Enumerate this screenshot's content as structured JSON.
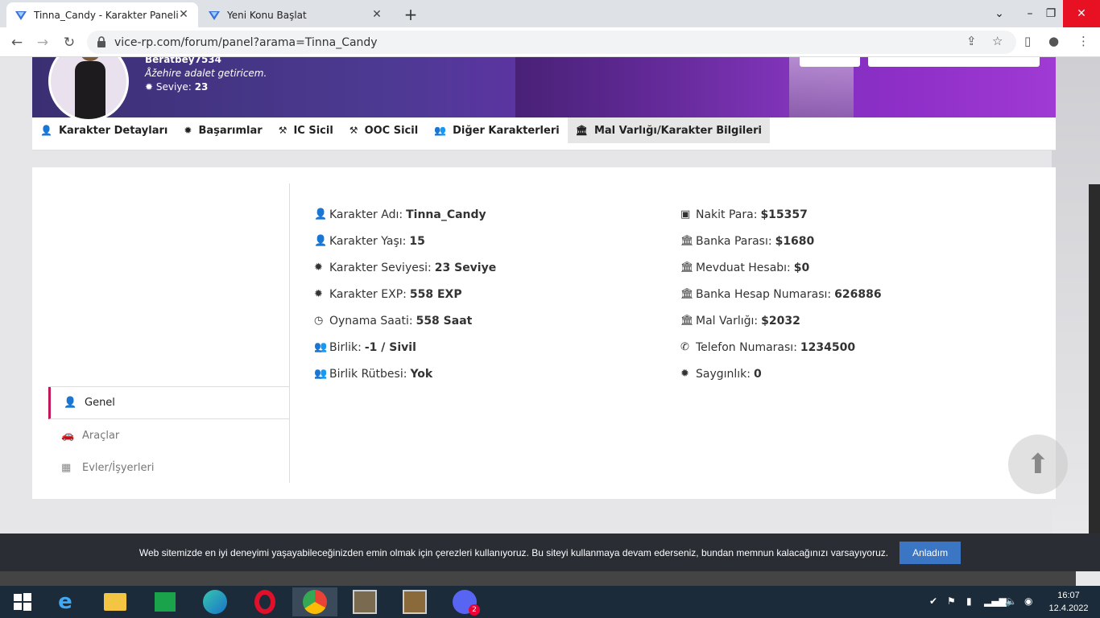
{
  "browser": {
    "tabs": [
      {
        "title": "Tinna_Candy - Karakter Paneli",
        "active": true
      },
      {
        "title": "Yeni Konu Başlat",
        "active": false
      }
    ],
    "url": "vice-rp.com/forum/panel?arama=Tinna_Candy"
  },
  "profile": {
    "username": "Beratbey7534",
    "motto": "Åžehire adalet getiricem.",
    "level_label": "Seviye:",
    "level_value": "23"
  },
  "profile_tabs": [
    {
      "label": "Karakter Detayları",
      "icon": "user-icon"
    },
    {
      "label": "Başarımlar",
      "icon": "gear-icon"
    },
    {
      "label": "IC Sicil",
      "icon": "gavel-icon"
    },
    {
      "label": "OOC Sicil",
      "icon": "gavel-icon"
    },
    {
      "label": "Diğer Karakterleri",
      "icon": "users-icon"
    },
    {
      "label": "Mal Varlığı/Karakter Bilgileri",
      "icon": "bank-icon",
      "selected": true
    }
  ],
  "sidebar": {
    "items": [
      {
        "label": "Genel",
        "icon": "user-icon",
        "active": true
      },
      {
        "label": "Araçlar",
        "icon": "car-icon"
      },
      {
        "label": "Evler/İşyerleri",
        "icon": "building-icon"
      }
    ]
  },
  "details_left": [
    {
      "label": "Karakter Adı:",
      "value": "Tinna_Candy",
      "icon": "user-icon"
    },
    {
      "label": "Karakter Yaşı:",
      "value": "15",
      "icon": "user-icon"
    },
    {
      "label": "Karakter Seviyesi:",
      "value": "23 Seviye",
      "icon": "gear-icon"
    },
    {
      "label": "Karakter EXP:",
      "value": "558 EXP",
      "icon": "gear-icon"
    },
    {
      "label": "Oynama Saati:",
      "value": "558 Saat",
      "icon": "clock-icon"
    },
    {
      "label": "Birlik:",
      "value": "-1 / Sivil",
      "icon": "users-icon"
    },
    {
      "label": "Birlik Rütbesi:",
      "value": "Yok",
      "icon": "users-icon"
    }
  ],
  "details_right": [
    {
      "label": "Nakit Para:",
      "value": "$15357",
      "icon": "money-icon"
    },
    {
      "label": "Banka Parası:",
      "value": "$1680",
      "icon": "bank-icon"
    },
    {
      "label": "Mevduat Hesabı:",
      "value": "$0",
      "icon": "bank-icon"
    },
    {
      "label": "Banka Hesap Numarası:",
      "value": "626886",
      "icon": "bank-icon"
    },
    {
      "label": "Mal Varlığı:",
      "value": "$2032",
      "icon": "bank-icon"
    },
    {
      "label": "Telefon Numarası:",
      "value": "1234500",
      "icon": "phone-icon"
    },
    {
      "label": "Saygınlık:",
      "value": "0",
      "icon": "gear-icon"
    }
  ],
  "cookie": {
    "text": "Web sitemizde en iyi deneyimi yaşayabileceğinizden emin olmak için çerezleri kullanıyoruz. Bu siteyi kullanmaya devam ederseniz, bundan memnun kalacağınızı varsayıyoruz.",
    "button": "Anladım"
  },
  "taskbar": {
    "time": "16:07",
    "date": "12.4.2022",
    "discord_badge": "2"
  },
  "colors": {
    "accent": "#c2185b",
    "banner_start": "#3b2f73",
    "banner_end": "#a03ad4",
    "cookie_button": "#3a76c4"
  }
}
